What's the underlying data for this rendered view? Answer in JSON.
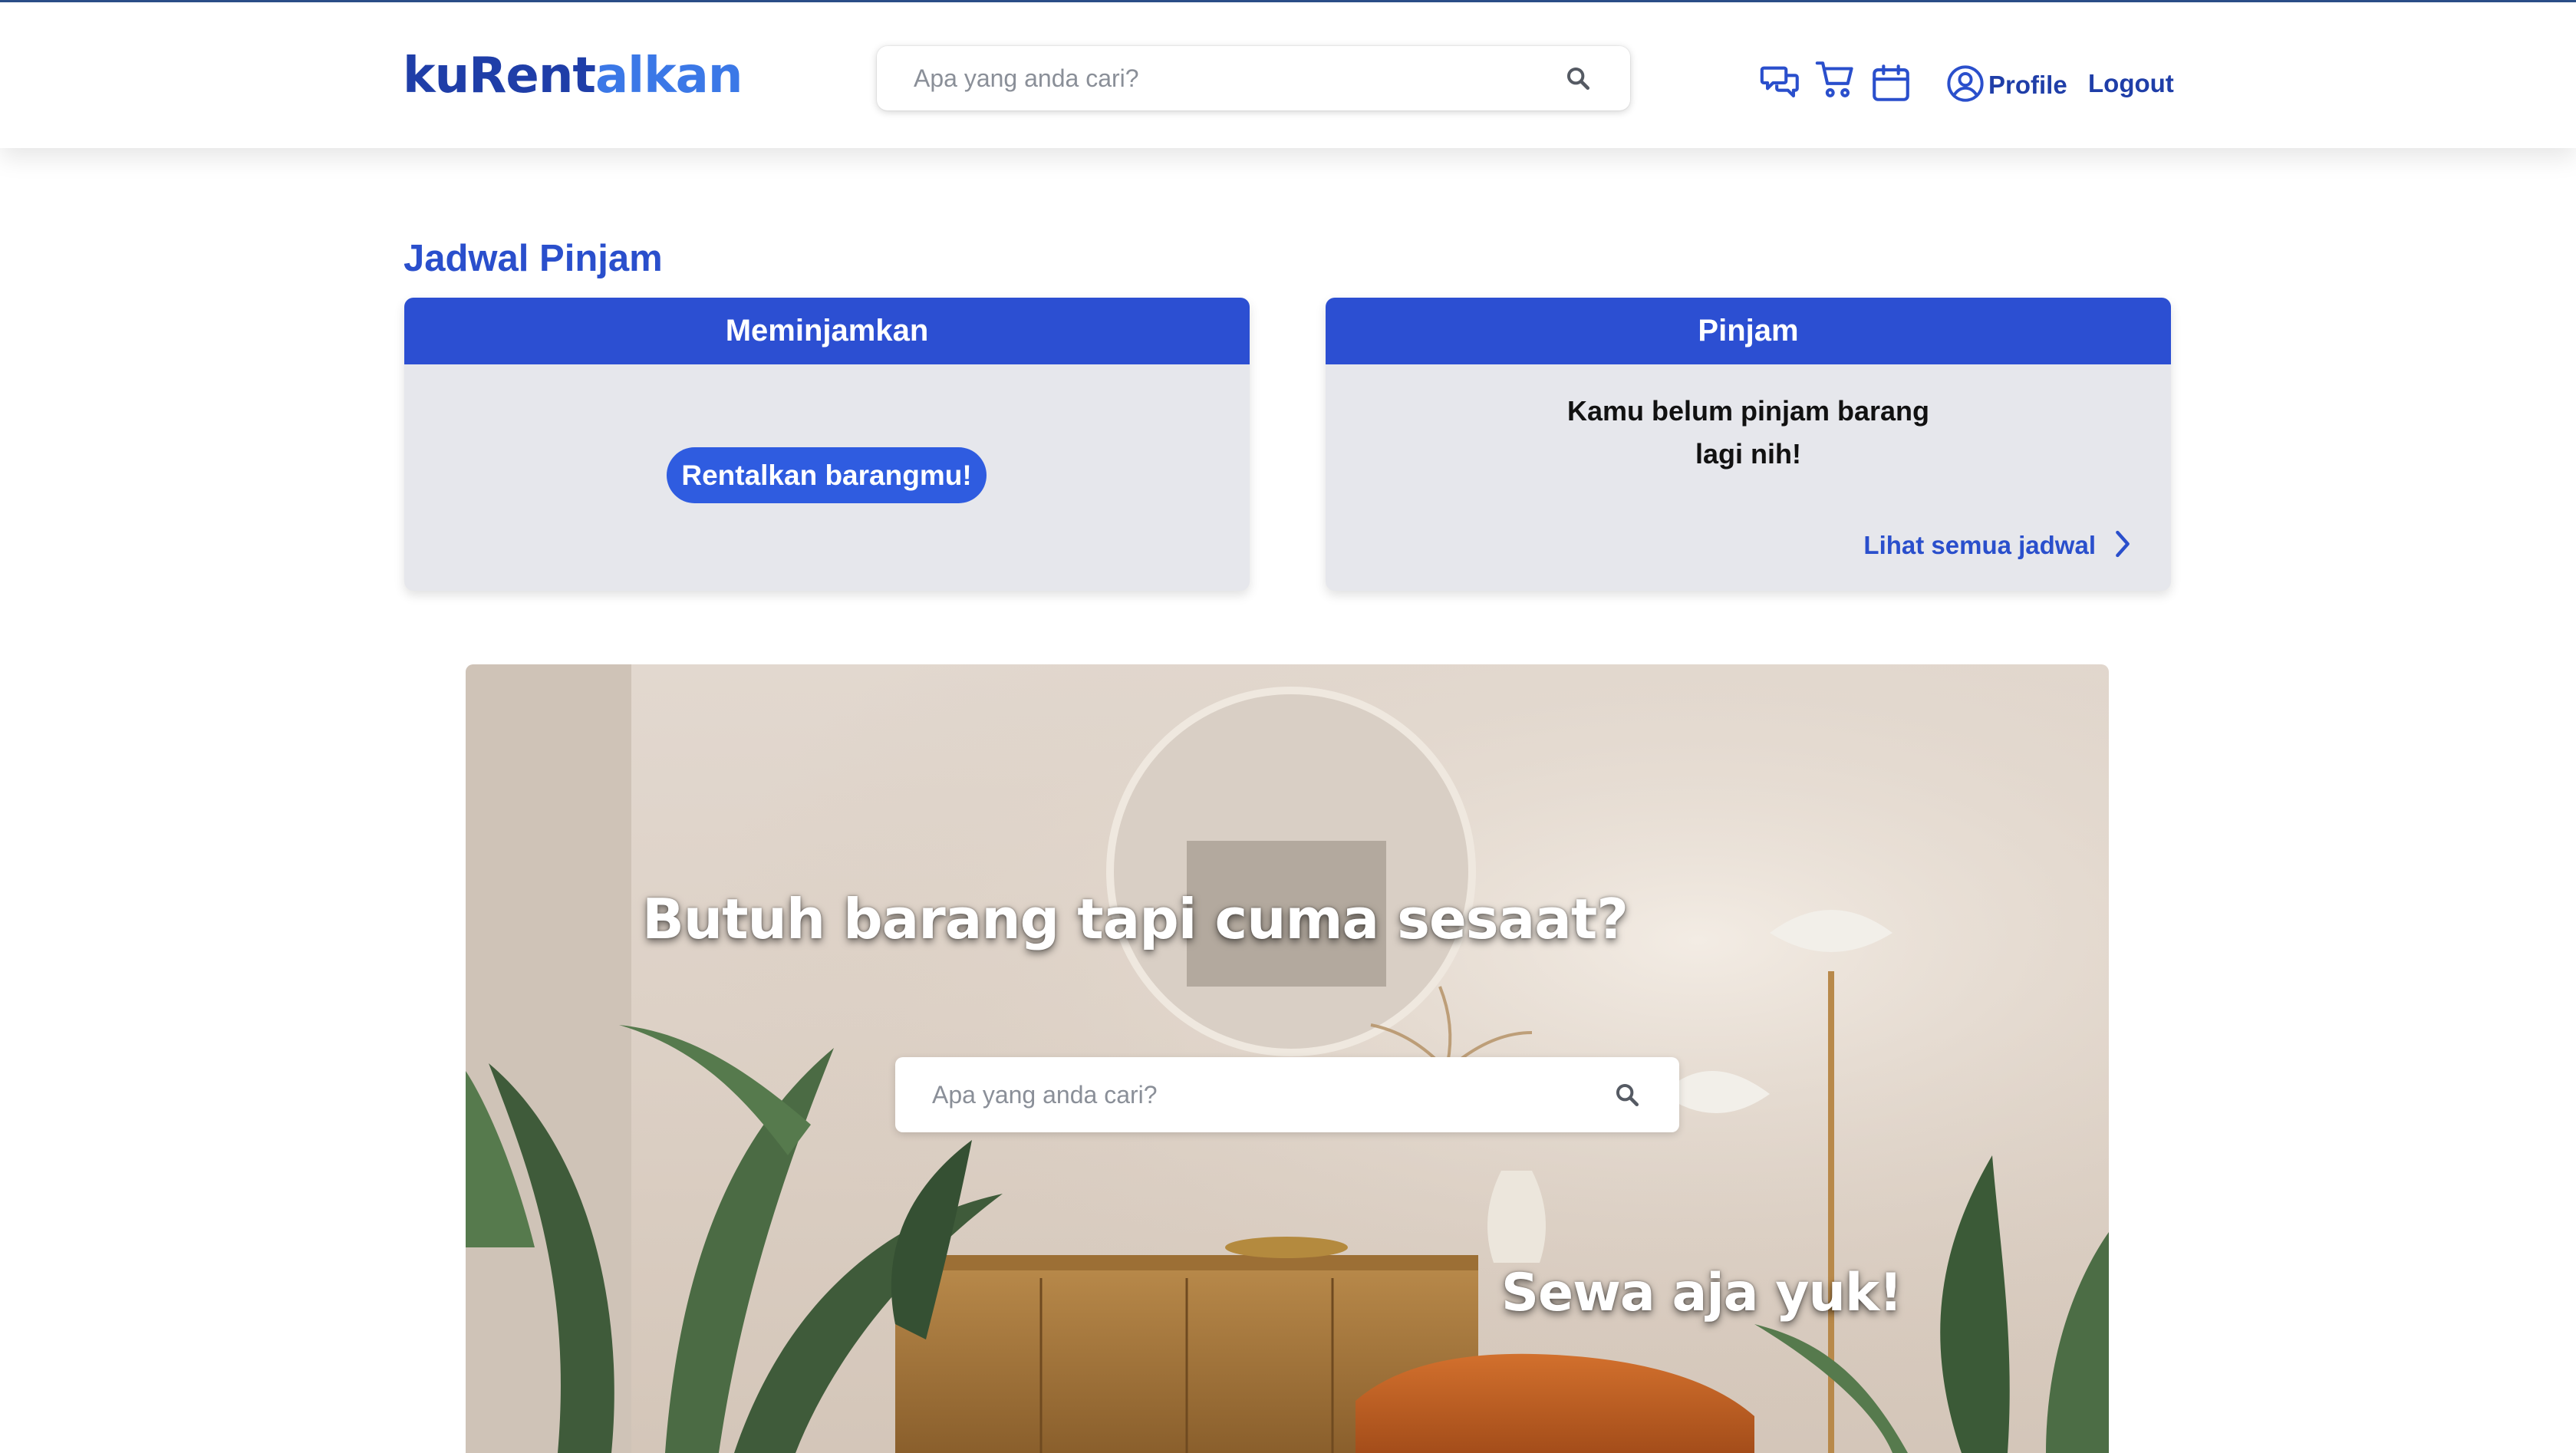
{
  "header": {
    "logo_part1": "kuRent",
    "logo_part2": "alkan",
    "search_placeholder": "Apa yang anda cari?",
    "icons": [
      "chat-icon",
      "cart-icon",
      "calendar-icon",
      "user-circle-icon"
    ],
    "profile_label": "Profile",
    "logout_label": "Logout"
  },
  "jadwal": {
    "title": "Jadwal Pinjam",
    "lend_card": {
      "header": "Meminjamkan",
      "button_label": "Rentalkan barangmu!"
    },
    "borrow_card": {
      "header": "Pinjam",
      "empty_line1": "Kamu belum pinjam barang",
      "empty_line2": "lagi nih!",
      "link_label": "Lihat semua jadwal"
    }
  },
  "hero": {
    "title": "Butuh barang tapi cuma sesaat?",
    "search_placeholder": "Apa yang anda cari?",
    "subtitle": "Sewa aja yuk!"
  },
  "colors": {
    "primary": "#2c4fd2",
    "brand_dark": "#1f3ea8",
    "brand_light": "#3b78e7",
    "card_bg": "#e6e7ec"
  }
}
